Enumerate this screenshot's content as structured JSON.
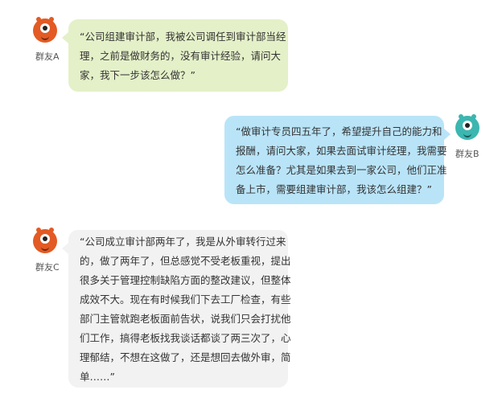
{
  "colors": {
    "avatar_orange": "#e35a24",
    "avatar_teal": "#3cb6b0",
    "bubble_green": "#e4f0c8",
    "bubble_blue": "#b9e4f8",
    "bubble_gray": "#f2f2f2"
  },
  "messages": [
    {
      "sender": "群友A",
      "avatar_icon": "orange-monster-avatar-icon",
      "lines": [
        "“公司组建审计部，我被公司调任到审计部当经",
        "理，之前是做财务的，没有审计经验，请问大",
        "家，我下一步该怎么做？”"
      ]
    },
    {
      "sender": "群友B",
      "avatar_icon": "teal-monster-avatar-icon",
      "lines": [
        "“做审计专员四五年了，希望提升自己的能力和",
        "报酬，请问大家，如果去面试审计经理，我需要",
        "怎么准备？尤其是如果去到一家公司，他们正准",
        "备上市，需要组建审计部，我该怎么组建？”"
      ]
    },
    {
      "sender": "群友C",
      "avatar_icon": "orange-monster-avatar-icon",
      "lines": [
        "“公司成立审计部两年了，我是从外审转行过来",
        "的，做了两年了，但总感觉不受老板重视，提出",
        "很多关于管理控制缺陷方面的整改建议，但整体",
        "成效不大。现在有时候我们下去工厂检查，有些",
        "部门主管就跑老板面前告状，说我们只会打扰他",
        "们工作，搞得老板找我谈话都谈了两三次了，心",
        "理郁结，不想在这做了，还是想回去做外审，简",
        "单……”"
      ]
    }
  ]
}
